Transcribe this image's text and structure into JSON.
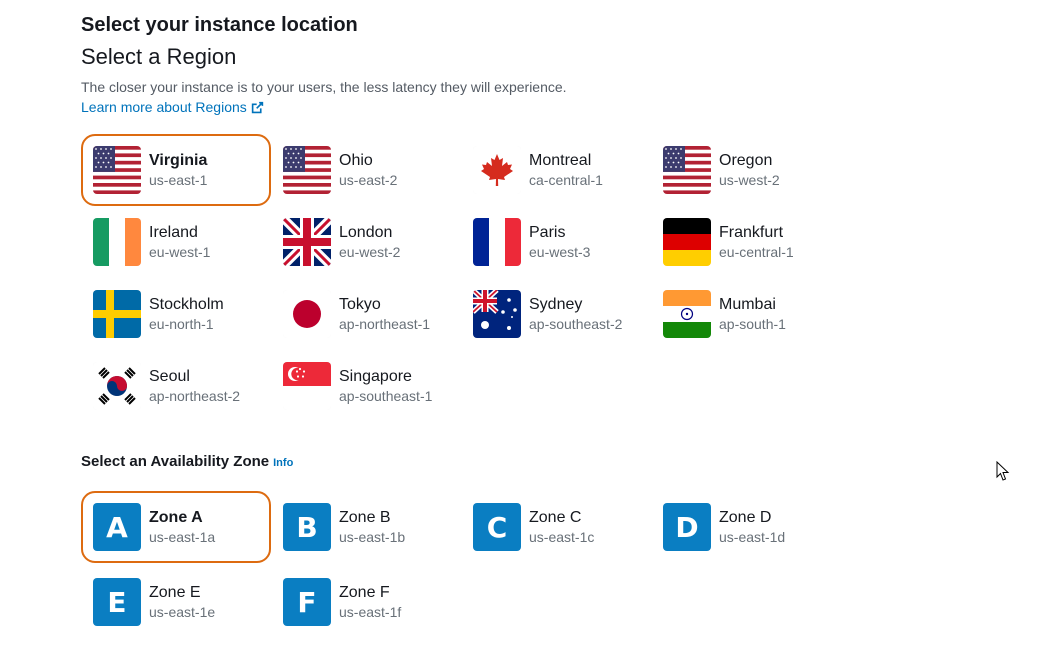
{
  "header": {
    "title": "Select your instance location",
    "subtitle": "Select a Region",
    "description": "The closer your instance is to your users, the less latency they will experience.",
    "learn_more": "Learn more about Regions"
  },
  "regions": [
    {
      "name": "Virginia",
      "code": "us-east-1",
      "flag": "us-flag",
      "selected": true
    },
    {
      "name": "Ohio",
      "code": "us-east-2",
      "flag": "us-flag"
    },
    {
      "name": "Montreal",
      "code": "ca-central-1",
      "flag": "canada-flag"
    },
    {
      "name": "Oregon",
      "code": "us-west-2",
      "flag": "us-flag"
    },
    {
      "name": "Ireland",
      "code": "eu-west-1",
      "flag": "ireland-flag"
    },
    {
      "name": "London",
      "code": "eu-west-2",
      "flag": "uk-flag"
    },
    {
      "name": "Paris",
      "code": "eu-west-3",
      "flag": "france-flag"
    },
    {
      "name": "Frankfurt",
      "code": "eu-central-1",
      "flag": "germany-flag"
    },
    {
      "name": "Stockholm",
      "code": "eu-north-1",
      "flag": "sweden-flag"
    },
    {
      "name": "Tokyo",
      "code": "ap-northeast-1",
      "flag": "japan-flag"
    },
    {
      "name": "Sydney",
      "code": "ap-southeast-2",
      "flag": "australia-flag"
    },
    {
      "name": "Mumbai",
      "code": "ap-south-1",
      "flag": "india-flag"
    },
    {
      "name": "Seoul",
      "code": "ap-northeast-2",
      "flag": "korea-flag"
    },
    {
      "name": "Singapore",
      "code": "ap-southeast-1",
      "flag": "singapore-flag"
    }
  ],
  "az": {
    "title": "Select an Availability Zone",
    "info": "Info",
    "zones": [
      {
        "letter": "A",
        "name": "Zone A",
        "code": "us-east-1a",
        "selected": true
      },
      {
        "letter": "B",
        "name": "Zone B",
        "code": "us-east-1b"
      },
      {
        "letter": "C",
        "name": "Zone C",
        "code": "us-east-1c"
      },
      {
        "letter": "D",
        "name": "Zone D",
        "code": "us-east-1d"
      },
      {
        "letter": "E",
        "name": "Zone E",
        "code": "us-east-1e"
      },
      {
        "letter": "F",
        "name": "Zone F",
        "code": "us-east-1f"
      }
    ]
  },
  "colors": {
    "accent": "#dd6b10",
    "link": "#0073bb",
    "zone_icon": "#0a7ec2"
  }
}
